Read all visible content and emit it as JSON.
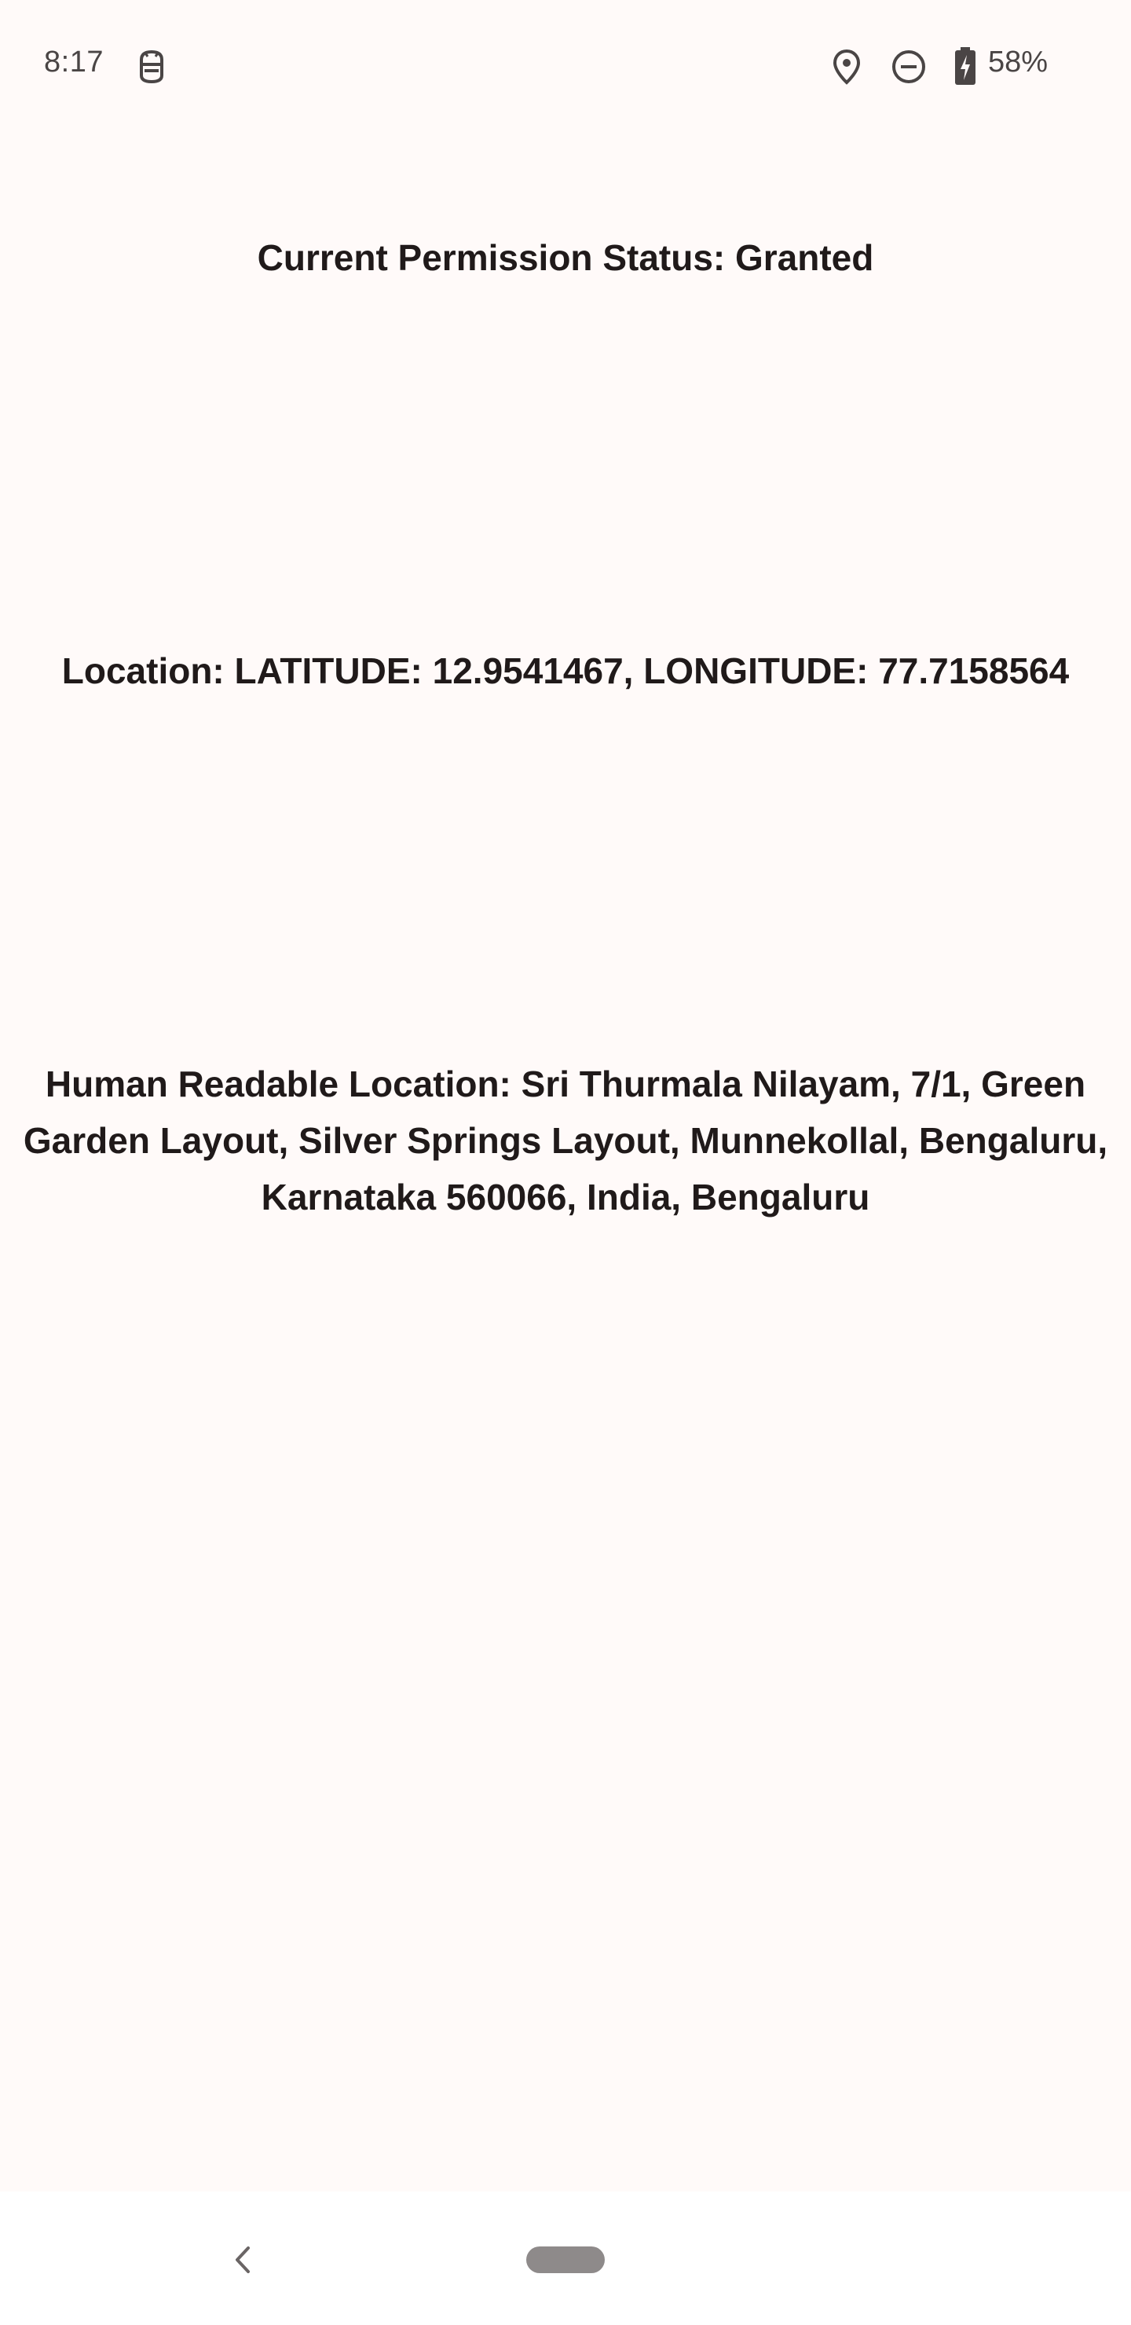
{
  "status_bar": {
    "time": "8:17",
    "notification_icon": "debug-robot-icon",
    "location_icon": "location-pin-icon",
    "dnd_icon": "do-not-disturb-icon",
    "battery_icon": "battery-charging-icon",
    "battery_percent": "58%"
  },
  "main": {
    "permission_status": "Current Permission Status: Granted",
    "location": "Location: LATITUDE: 12.9541467, LONGITUDE: 77.7158564",
    "human_readable_location": "Human Readable Location: Sri Thurmala Nilayam, 7/1, Green Garden Layout, Silver Springs Layout, Munnekollal, Bengaluru, Karnataka 560066, India, Bengaluru"
  },
  "nav_bar": {
    "back_icon": "back-chevron-icon",
    "home_icon": "home-pill-icon"
  },
  "colors": {
    "background": "#fffaf9",
    "text": "#201a1a",
    "status_text": "#4a4545",
    "nav_background": "#ffffff",
    "home_pill": "#8e8a8a"
  }
}
